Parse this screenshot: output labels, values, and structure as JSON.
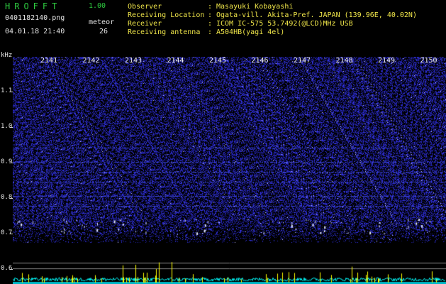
{
  "header": {
    "title": "HROFFT",
    "version": "1.00",
    "filename": "0401182140.png",
    "meteor_label": "meteor",
    "timestamp": "04.01.18 21:40",
    "meteor_count": "26"
  },
  "info": [
    {
      "key": "Observer",
      "value": "Masayuki Kobayashi"
    },
    {
      "key": "Receiving Location",
      "value": "Ogata-vill. Akita-Pref. JAPAN (139.96E, 40.02N)"
    },
    {
      "key": "Receiver",
      "value": "ICOM IC-575 53.7492(@LCD)MHz USB"
    },
    {
      "key": "Receiving antenna",
      "value": "A504HB(yagi 4el)"
    }
  ],
  "info_sep": ":",
  "axis": {
    "y_unit": "kHz",
    "y_ticks": [
      "1.1",
      "1.0",
      "0.9",
      "0.8",
      "0.7",
      "0.6"
    ],
    "x_ticks": [
      "2141",
      "2142",
      "2143",
      "2144",
      "2145",
      "2146",
      "2147",
      "2148",
      "2149",
      "2150"
    ]
  },
  "colors": {
    "noise": "#1a1aa8",
    "echo": "#ffffff",
    "trace": "#00ffff",
    "spike": "#ffff00",
    "title": "#2ecc40",
    "info": "#f0e64a"
  }
}
